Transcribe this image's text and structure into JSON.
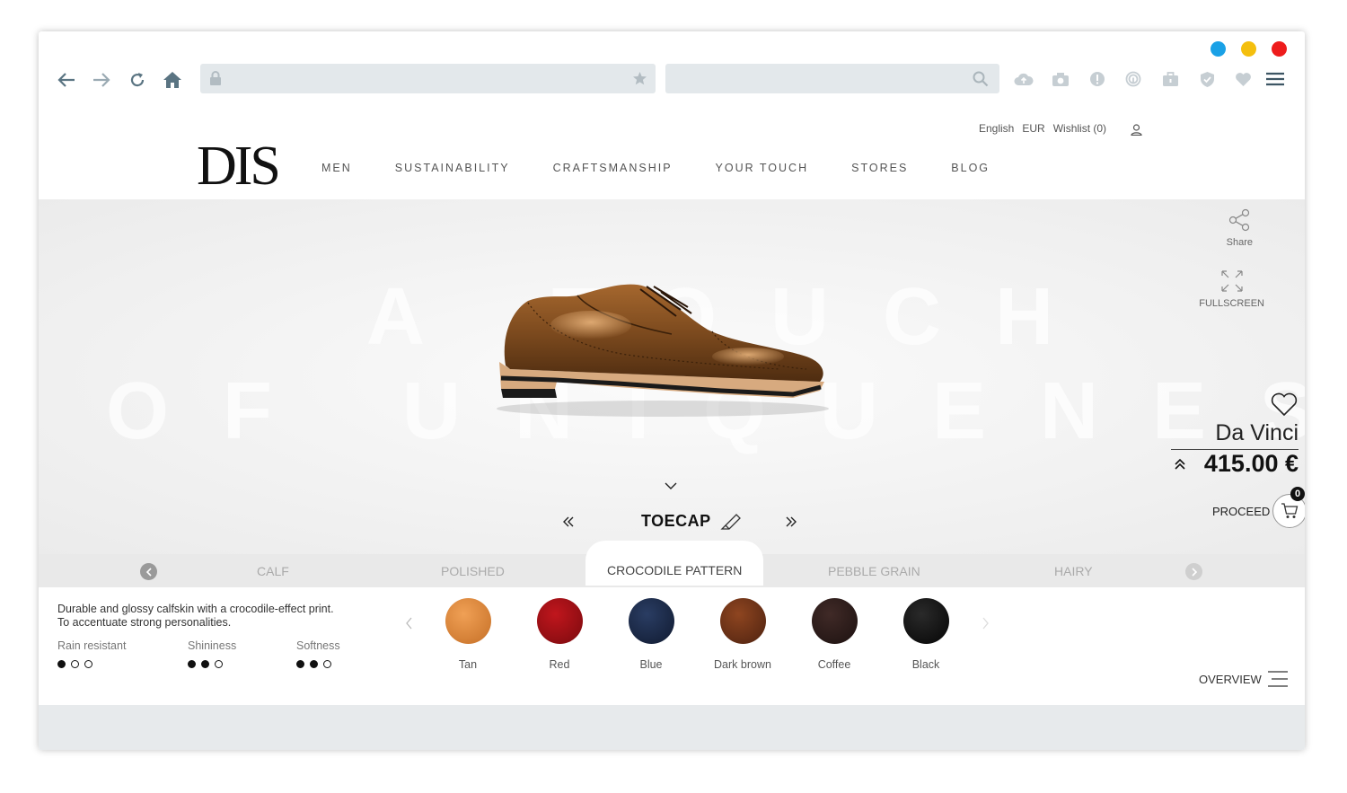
{
  "browser": {
    "window_dot_colors": [
      "#1aa1e6",
      "#f4bf0e",
      "#ee1c1c"
    ]
  },
  "topbar": {
    "language": "English",
    "currency": "EUR",
    "wishlist": "Wishlist (0)"
  },
  "logo": "DIS",
  "nav": [
    "MEN",
    "SUSTAINABILITY",
    "CRAFTSMANSHIP",
    "YOUR TOUCH",
    "STORES",
    "BLOG"
  ],
  "watermark": {
    "line1": "A TOUCH",
    "line2": "OF UNIQUENESS"
  },
  "side_tools": {
    "share": "Share",
    "fullscreen": "FULLSCREEN"
  },
  "product": {
    "name": "Da Vinci",
    "price": "415.00 €",
    "proceed": "PROCEED",
    "cart_count": "0"
  },
  "part": "TOECAP",
  "leather_tabs": [
    "CALF",
    "POLISHED",
    "CROCODILE PATTERN",
    "PEBBLE GRAIN",
    "HAIRY"
  ],
  "active_tab": "CROCODILE PATTERN",
  "description": {
    "line1": "Durable and glossy calfskin with a crocodile-effect print.",
    "line2": "To accentuate strong personalities."
  },
  "ratings": [
    {
      "label": "Rain resistant",
      "value": 1,
      "max": 3
    },
    {
      "label": "Shininess",
      "value": 2,
      "max": 3
    },
    {
      "label": "Softness",
      "value": 2,
      "max": 3
    }
  ],
  "colors": [
    {
      "name": "Tan",
      "hex": "#e08a3c"
    },
    {
      "name": "Red",
      "hex": "#9b0d12"
    },
    {
      "name": "Blue",
      "hex": "#1a2845"
    },
    {
      "name": "Dark brown",
      "hex": "#6a2f14"
    },
    {
      "name": "Coffee",
      "hex": "#2a1a18"
    },
    {
      "name": "Black",
      "hex": "#141414"
    }
  ],
  "overview": "OVERVIEW"
}
